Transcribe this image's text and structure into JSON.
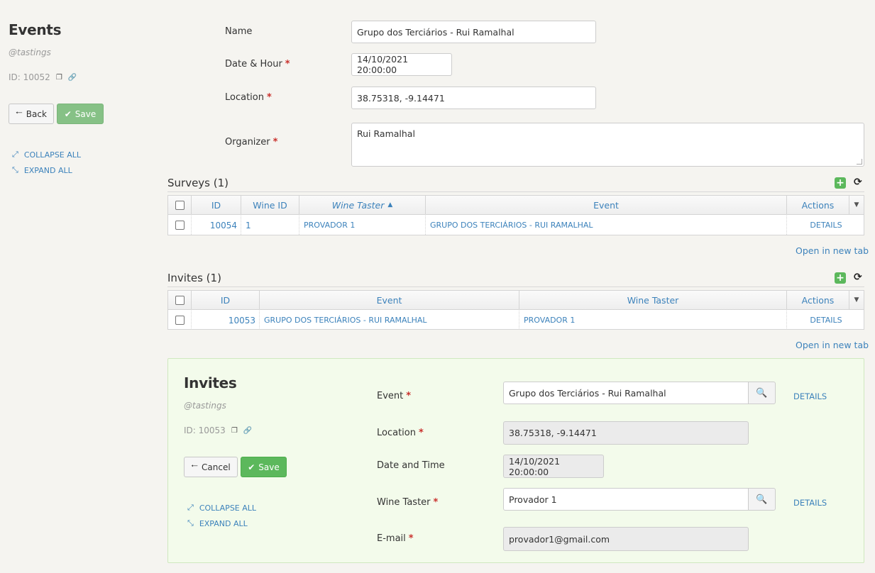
{
  "sidebar": {
    "title": "Events",
    "subtitle": "@tastings",
    "id_text": "ID: 10052",
    "back_label": "Back",
    "save_label": "Save",
    "collapse_all": "COLLAPSE ALL",
    "expand_all": "EXPAND ALL"
  },
  "form": {
    "name_label": "Name",
    "name_value": "Grupo dos Terciários - Rui Ramalhal",
    "date_label": "Date & Hour",
    "date_value": "14/10/2021 20:00:00",
    "location_label": "Location",
    "location_value": "38.75318, -9.14471",
    "organizer_label": "Organizer",
    "organizer_value": "Rui Ramalhal",
    "required_mark": "*"
  },
  "surveys": {
    "title": "Surveys (1)",
    "columns": [
      "ID",
      "Wine ID",
      "Wine Taster",
      "Event",
      "Actions"
    ],
    "rows": [
      {
        "id": "10054",
        "wine_id": "1",
        "wine_taster": "PROVADOR 1",
        "event": "GRUPO DOS TERCIÁRIOS - RUI RAMALHAL",
        "action": "DETAILS"
      }
    ],
    "open_new_tab": "Open in new tab"
  },
  "invites": {
    "title": "Invites (1)",
    "columns": [
      "ID",
      "Event",
      "Wine Taster",
      "Actions"
    ],
    "rows": [
      {
        "id": "10053",
        "event": "GRUPO DOS TERCIÁRIOS - RUI RAMALHAL",
        "wine_taster": "PROVADOR 1",
        "action": "DETAILS"
      }
    ],
    "open_new_tab": "Open in new tab"
  },
  "invite_detail": {
    "title": "Invites",
    "subtitle": "@tastings",
    "id_text": "ID: 10053",
    "cancel_label": "Cancel",
    "save_label": "Save",
    "collapse_all": "COLLAPSE ALL",
    "expand_all": "EXPAND ALL",
    "event_label": "Event",
    "event_value": "Grupo dos Terciários - Rui Ramalhal",
    "event_details": "DETAILS",
    "location_label": "Location",
    "location_value": "38.75318, -9.14471",
    "date_label": "Date and Time",
    "date_value": "14/10/2021 20:00:00",
    "taster_label": "Wine Taster",
    "taster_value": "Provador 1",
    "taster_details": "DETAILS",
    "email_label": "E-mail",
    "email_value": "provador1@gmail.com"
  },
  "colors": {
    "link": "#3c82bb",
    "required": "#c9302c",
    "save_green": "#5cb85c",
    "panel_bg": "#f3fbeb"
  },
  "icons": [
    "copy-icon",
    "link-icon",
    "arrow-left-icon",
    "check-icon",
    "collapse-icon",
    "expand-icon",
    "plus-icon",
    "refresh-icon",
    "sort-asc-icon",
    "caret-down-icon",
    "search-icon"
  ]
}
